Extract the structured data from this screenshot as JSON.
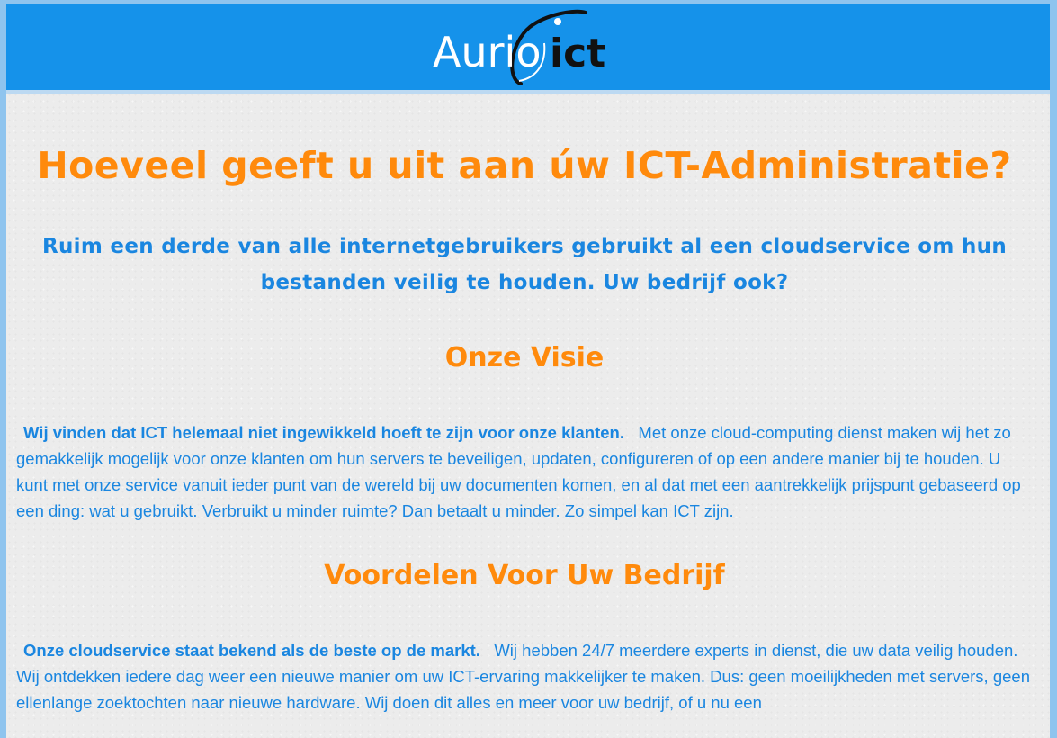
{
  "header": {
    "logo": {
      "word1": "Aurio",
      "word2": "ict"
    }
  },
  "main": {
    "headline": "Hoeveel geeft u uit aan úw ICT-Administratie?",
    "subheadline": "Ruim een derde van alle internetgebruikers gebruikt al een cloudservice om hun bestanden veilig te houden. Uw bedrijf ook?",
    "sections": [
      {
        "title": "Onze Visie",
        "lead": "Wij vinden dat ICT helemaal niet ingewikkeld hoeft te zijn voor onze klanten.",
        "body": "Met onze cloud-computing dienst maken wij het zo gemakkelijk mogelijk voor onze klanten om hun servers te beveiligen, updaten, configureren of op een andere manier bij te houden. U kunt met onze service vanuit ieder punt van de wereld bij uw documenten komen, en al dat met een aantrekkelijk prijspunt gebaseerd op een ding: wat u gebruikt. Verbruikt u minder ruimte? Dan betaalt u minder. Zo simpel kan ICT zijn."
      },
      {
        "title": "Voordelen Voor Uw Bedrijf",
        "lead": "Onze cloudservice staat bekend als de beste op de markt.",
        "body": "Wij hebben 24/7 meerdere experts in dienst, die uw data veilig houden. Wij ontdekken iedere dag weer een nieuwe manier om uw ICT-ervaring makkelijker te maken. Dus: geen moeilijkheden met servers, geen ellenlange zoektochten naar nieuwe hardware. Wij doen dit alles en meer voor uw bedrijf, of u nu een"
      }
    ]
  },
  "colors": {
    "header_bg": "#1592ea",
    "accent_orange": "#ff8a0c",
    "text_blue": "#1a86e0",
    "page_bg": "#ececec"
  }
}
